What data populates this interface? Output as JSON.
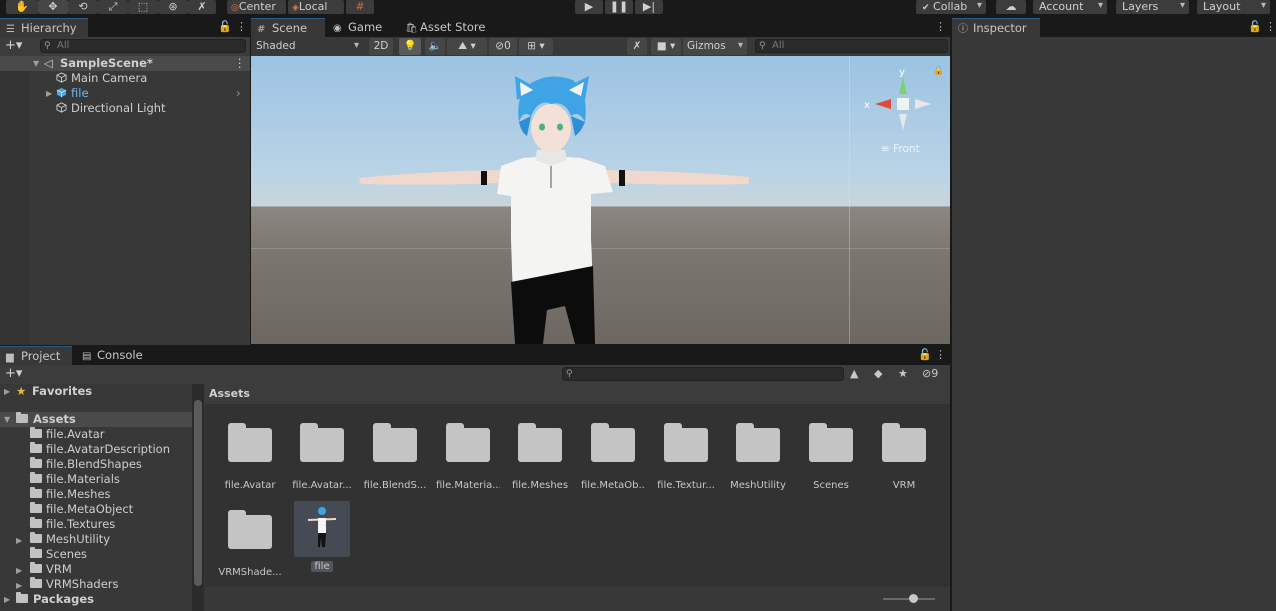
{
  "toolbar": {
    "pivot": "Center",
    "space": "Local",
    "collab": "Collab",
    "account": "Account",
    "layers": "Layers",
    "layout": "Layout"
  },
  "hierarchy": {
    "tab": "Hierarchy",
    "search_placeholder": "All",
    "scene_name": "SampleScene*",
    "items": [
      {
        "label": "Main Camera"
      },
      {
        "label": "file"
      },
      {
        "label": "Directional Light"
      }
    ]
  },
  "scene": {
    "tabs": [
      "Scene",
      "Game",
      "Asset Store"
    ],
    "shading": "Shaded",
    "mode_2d": "2D",
    "hidden_count": "0",
    "gizmos": "Gizmos",
    "search_placeholder": "All",
    "gizmo_axis_y": "y",
    "gizmo_axis_x": "x",
    "view_label": "Front"
  },
  "inspector": {
    "tab": "Inspector"
  },
  "project": {
    "tabs": [
      "Project",
      "Console"
    ],
    "hidden_count": "9",
    "breadcrumb": "Assets",
    "tree": {
      "favorites": "Favorites",
      "assets": "Assets",
      "children": [
        {
          "label": "file.Avatar"
        },
        {
          "label": "file.AvatarDescription"
        },
        {
          "label": "file.BlendShapes"
        },
        {
          "label": "file.Materials"
        },
        {
          "label": "file.Meshes"
        },
        {
          "label": "file.MetaObject"
        },
        {
          "label": "file.Textures"
        },
        {
          "label": "MeshUtility"
        },
        {
          "label": "Scenes"
        },
        {
          "label": "VRM"
        },
        {
          "label": "VRMShaders"
        }
      ],
      "packages": "Packages"
    },
    "assets": [
      {
        "label": "file.Avatar"
      },
      {
        "label": "file.Avatar..."
      },
      {
        "label": "file.BlendS..."
      },
      {
        "label": "file.Materia..."
      },
      {
        "label": "file.Meshes"
      },
      {
        "label": "file.MetaOb..."
      },
      {
        "label": "file.Textur..."
      },
      {
        "label": "MeshUtility"
      },
      {
        "label": "Scenes"
      },
      {
        "label": "VRM"
      },
      {
        "label": "VRMShade..."
      },
      {
        "label": "file"
      }
    ]
  },
  "colors": {
    "selection": "#2c5d87",
    "panel": "#383838",
    "hair": "#3fa4e6"
  }
}
